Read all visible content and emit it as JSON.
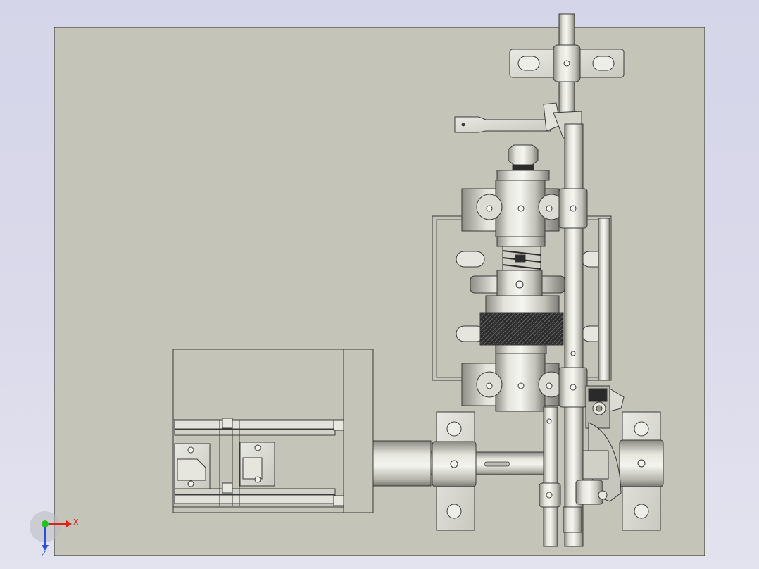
{
  "app": {
    "view": "cad-model-viewport"
  },
  "colors": {
    "background_top": "#d5d5e9",
    "background_bottom": "#e3e3ef",
    "sheet_fill": "#c4c4b9",
    "sheet_edge": "#2a2a2a",
    "part_light": "#efefea",
    "part_mid": "#cfcfc6",
    "part_dark": "#9a9a90",
    "knurl": "#1e1e1e",
    "axis_x": "#e0211c",
    "axis_y": "#25c21f",
    "axis_z": "#2b4fd6"
  },
  "triad": {
    "x_label": "X",
    "z_label": "Z",
    "y_label": ""
  }
}
